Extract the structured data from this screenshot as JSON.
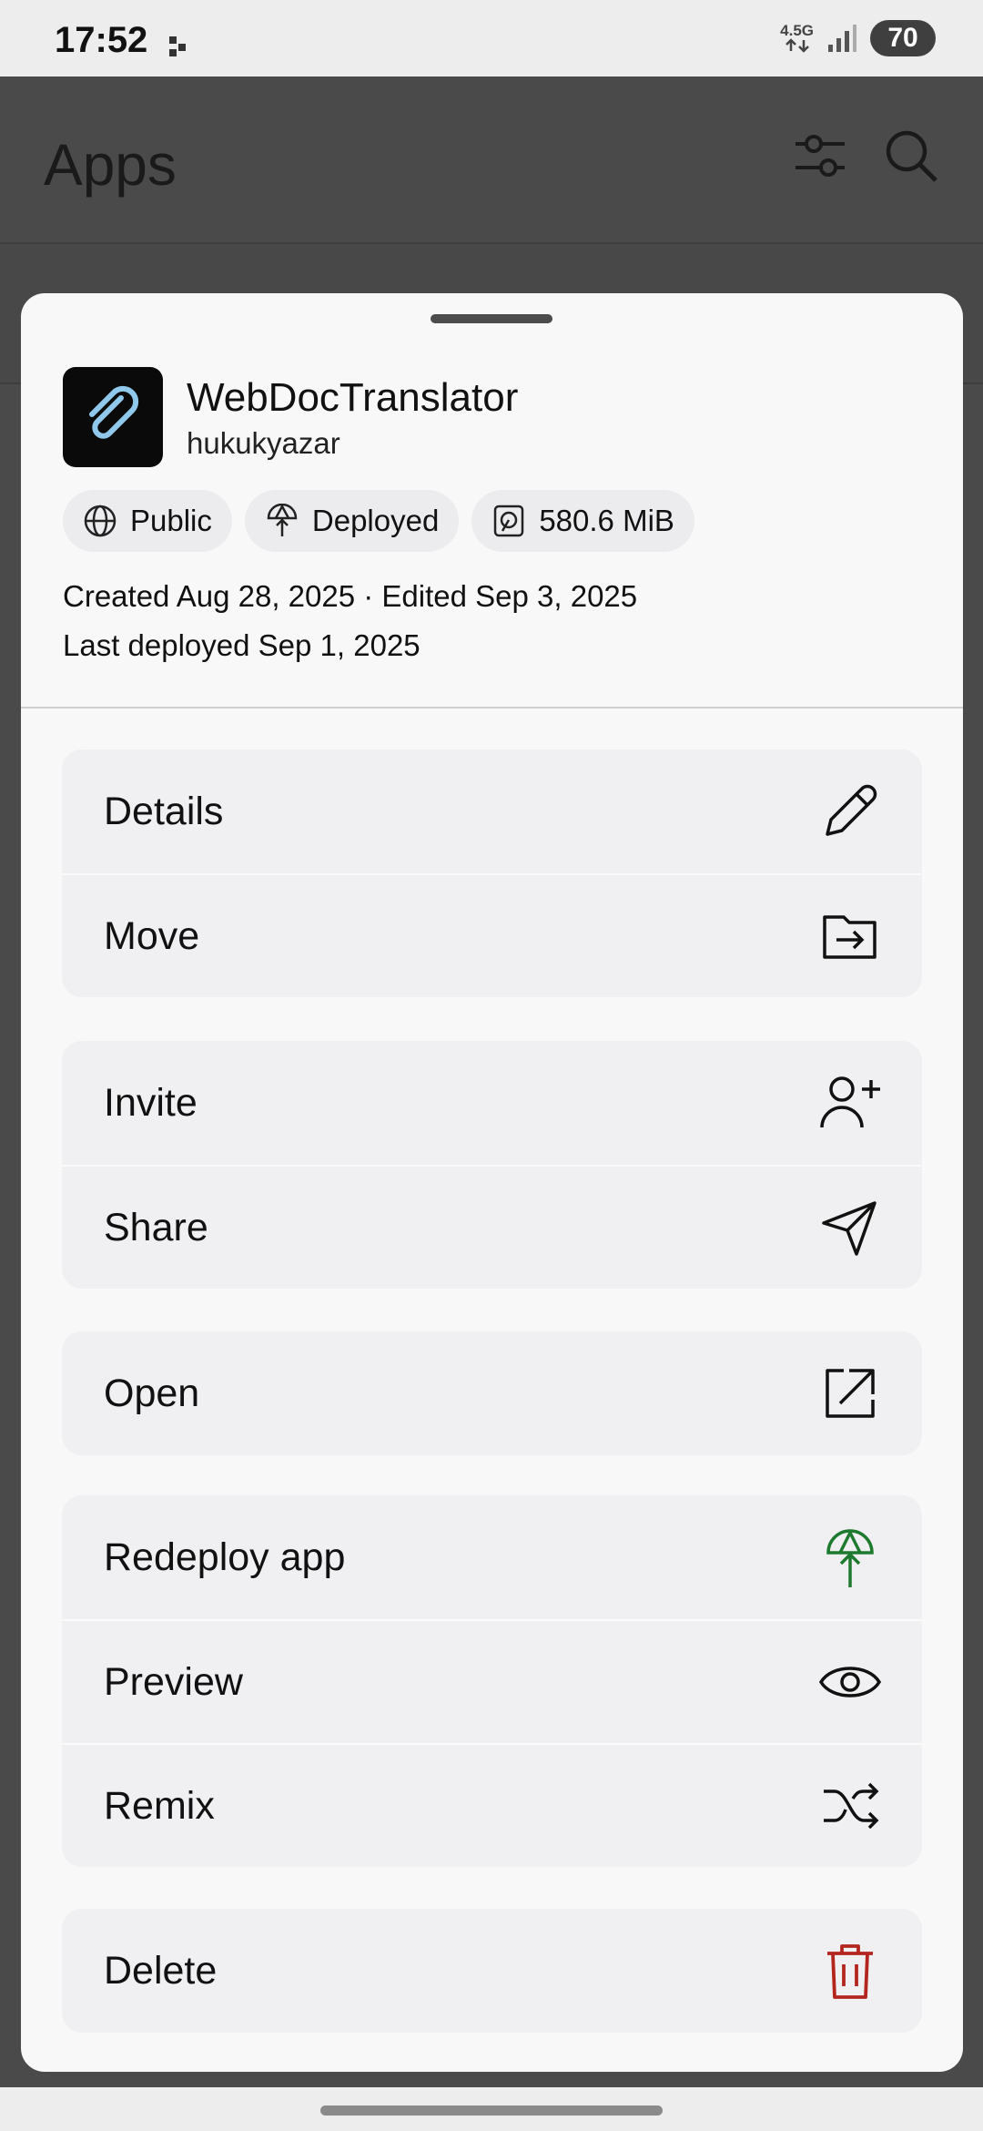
{
  "status_bar": {
    "time": "17:52",
    "network": "4.5G",
    "battery": "70"
  },
  "app_bar": {
    "title": "Apps"
  },
  "sheet": {
    "app": {
      "name": "WebDocTranslator",
      "owner": "hukukyazar"
    },
    "chips": [
      {
        "label": "Public",
        "icon": "globe-icon"
      },
      {
        "label": "Deployed",
        "icon": "deploy-icon"
      },
      {
        "label": "580.6 MiB",
        "icon": "storage-icon"
      }
    ],
    "meta_line1": "Created Aug 28, 2025 · Edited Sep 3, 2025",
    "meta_line2": "Last deployed Sep 1, 2025",
    "groups": [
      [
        {
          "label": "Details",
          "icon": "pencil-icon"
        },
        {
          "label": "Move",
          "icon": "folder-move-icon"
        }
      ],
      [
        {
          "label": "Invite",
          "icon": "user-plus-icon"
        },
        {
          "label": "Share",
          "icon": "send-icon"
        }
      ],
      [
        {
          "label": "Open",
          "icon": "open-external-icon"
        }
      ],
      [
        {
          "label": "Redeploy app",
          "icon": "redeploy-icon"
        },
        {
          "label": "Preview",
          "icon": "eye-icon"
        },
        {
          "label": "Remix",
          "icon": "shuffle-icon"
        }
      ],
      [
        {
          "label": "Delete",
          "icon": "trash-icon"
        }
      ]
    ]
  },
  "colors": {
    "accent_green": "#1e7a2e",
    "danger_red": "#b3261e",
    "app_icon_clip": "#8fc8ea"
  }
}
